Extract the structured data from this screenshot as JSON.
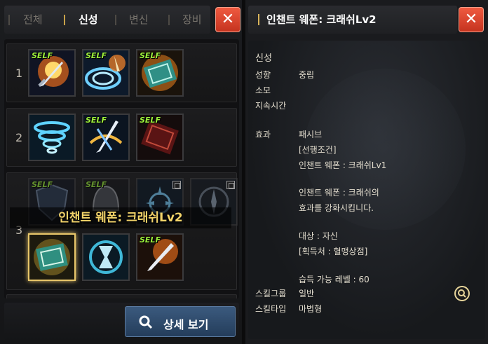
{
  "left_panel": {
    "tabs": [
      "전체",
      "신성",
      "변신",
      "장비"
    ],
    "active_tab": 1,
    "close_label": "✕",
    "rows": [
      {
        "number": "1",
        "skills": [
          {
            "self": true,
            "icon": "sword-flame-icon"
          },
          {
            "self": true,
            "icon": "whirlwind-sword-icon"
          },
          {
            "self": true,
            "icon": "spellbook-icon"
          }
        ]
      },
      {
        "number": "2",
        "skills": [
          {
            "self": false,
            "icon": "tornado-icon"
          },
          {
            "self": true,
            "icon": "swords-swirl-icon"
          },
          {
            "self": true,
            "icon": "red-book-icon"
          }
        ]
      },
      {
        "number": "3",
        "skills": [
          {
            "self": true,
            "icon": "shield-icon",
            "dim": true
          },
          {
            "self": true,
            "icon": "helmet-icon",
            "dim": true
          },
          {
            "self": false,
            "icon": "sun-crest-icon",
            "lock": true,
            "dim": true
          },
          {
            "self": false,
            "icon": "compass-icon",
            "lock": true,
            "dim": true
          },
          {
            "self": false,
            "icon": "enchant-book-icon",
            "selected": true
          },
          {
            "self": false,
            "icon": "hourglass-icon"
          },
          {
            "self": true,
            "icon": "flame-sword-icon"
          }
        ]
      }
    ],
    "self_label": "SELF",
    "hover_label": "인챈트 웨폰: 크래쉬Lv2",
    "detail_button": "상세 보기"
  },
  "right_panel": {
    "title": "인챈트 웨폰: 크래쉬Lv2",
    "close_label": "✕",
    "category": "신성",
    "fields": [
      {
        "key": "성향",
        "value": "중립"
      },
      {
        "key": "소모",
        "value": ""
      },
      {
        "key": "지속시간",
        "value": ""
      }
    ],
    "effect_key": "효과",
    "effect_lines": [
      "패시브",
      "[선행조건]",
      "인챈트 웨폰 : 크래쉬Lv1",
      "",
      "인챈트 웨폰 : 크래쉬의",
      "효과를 강화시킵니다.",
      "",
      "대상 : 자신",
      "[획득처 : 혈맹상점]",
      "",
      "습득 가능 레벨 : 60"
    ],
    "bottom_fields": [
      {
        "key": "스킬그룹",
        "value": "일반"
      },
      {
        "key": "스킬타입",
        "value": "마법형"
      }
    ]
  },
  "colors": {
    "accent_gold": "#e8c66a",
    "close_red": "#d8432b",
    "self_green": "#9df03c",
    "button_blue": "#2f4c6e"
  }
}
